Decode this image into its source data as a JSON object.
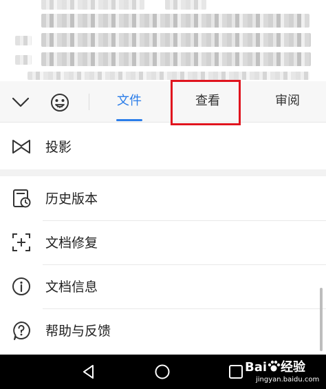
{
  "toolbar": {
    "tabs": [
      {
        "label": "文件",
        "active": true
      },
      {
        "label": "查看",
        "active": false,
        "highlighted": true
      },
      {
        "label": "审阅",
        "active": false
      }
    ],
    "accent_color": "#2b7de9",
    "highlight_color": "#e0141e"
  },
  "menu": {
    "projection": {
      "label": "投影",
      "icon": "projection-icon"
    },
    "items": [
      {
        "label": "历史版本",
        "icon": "history-version-icon"
      },
      {
        "label": "文档修复",
        "icon": "doc-repair-icon"
      },
      {
        "label": "文档信息",
        "icon": "info-icon"
      },
      {
        "label": "帮助与反馈",
        "icon": "help-feedback-icon"
      }
    ]
  },
  "watermark": {
    "brand": "Bai",
    "brand_suffix": "经验",
    "url": "jingyan.baidu.com"
  }
}
